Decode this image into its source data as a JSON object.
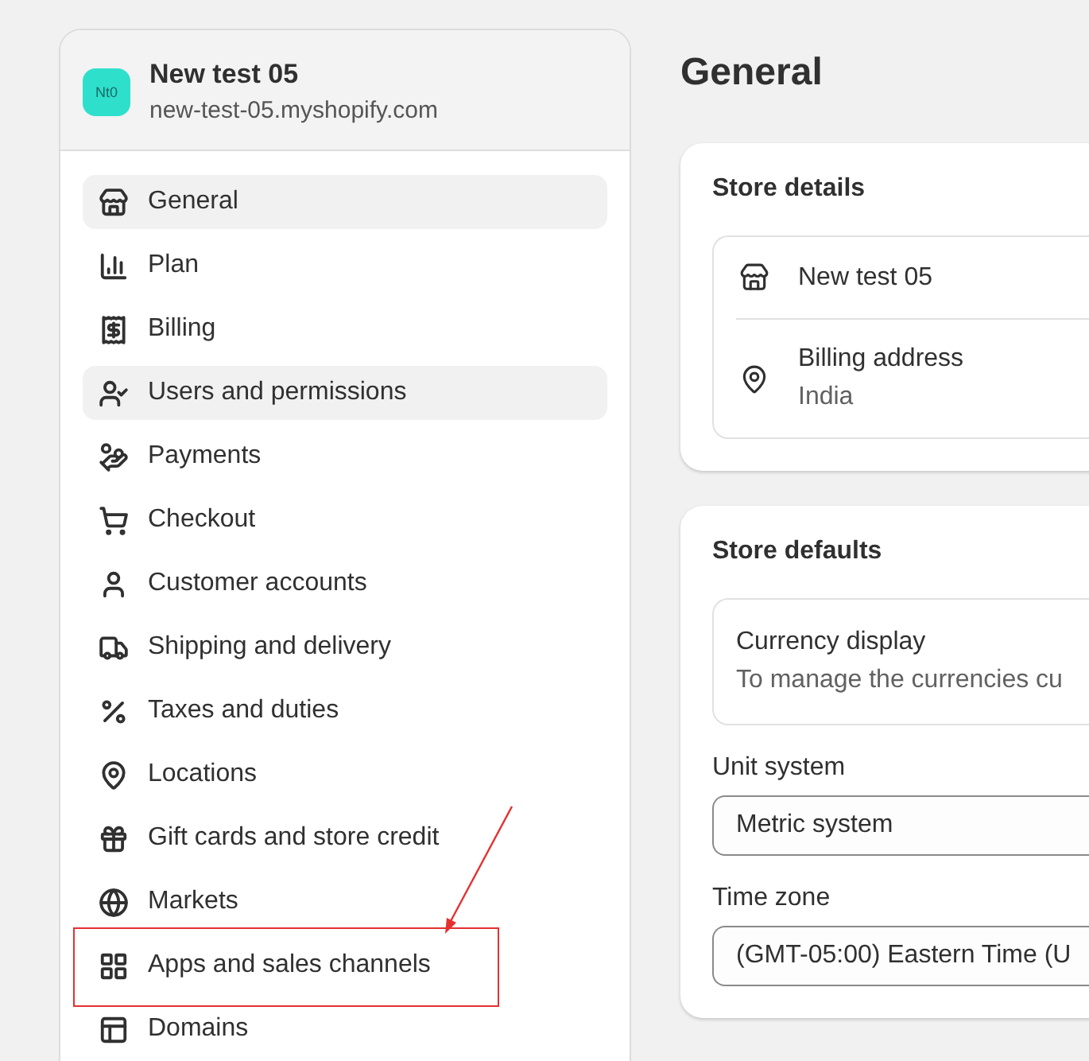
{
  "store": {
    "badge": "Nt0",
    "name": "New test 05",
    "domain": "new-test-05.myshopify.com"
  },
  "sidebar": {
    "items": [
      {
        "label": "General",
        "highlighted": true,
        "annotated": false
      },
      {
        "label": "Plan",
        "highlighted": false,
        "annotated": false
      },
      {
        "label": "Billing",
        "highlighted": false,
        "annotated": false
      },
      {
        "label": "Users and permissions",
        "highlighted": true,
        "annotated": false
      },
      {
        "label": "Payments",
        "highlighted": false,
        "annotated": false
      },
      {
        "label": "Checkout",
        "highlighted": false,
        "annotated": false
      },
      {
        "label": "Customer accounts",
        "highlighted": false,
        "annotated": false
      },
      {
        "label": "Shipping and delivery",
        "highlighted": false,
        "annotated": false
      },
      {
        "label": "Taxes and duties",
        "highlighted": false,
        "annotated": false
      },
      {
        "label": "Locations",
        "highlighted": false,
        "annotated": false
      },
      {
        "label": "Gift cards and store credit",
        "highlighted": false,
        "annotated": false
      },
      {
        "label": "Markets",
        "highlighted": false,
        "annotated": false
      },
      {
        "label": "Apps and sales channels",
        "highlighted": false,
        "annotated": true
      },
      {
        "label": "Domains",
        "highlighted": false,
        "annotated": false
      }
    ]
  },
  "page_title": "General",
  "store_details": {
    "title": "Store details",
    "name": "New test 05",
    "billing_label": "Billing address",
    "billing_value": "India"
  },
  "store_defaults": {
    "title": "Store defaults",
    "currency_title": "Currency display",
    "currency_text": "To manage the currencies cu",
    "fields": [
      {
        "label": "Unit system",
        "value": "Metric system"
      },
      {
        "label": "Time zone",
        "value": "(GMT-05:00) Eastern Time (U"
      }
    ]
  }
}
